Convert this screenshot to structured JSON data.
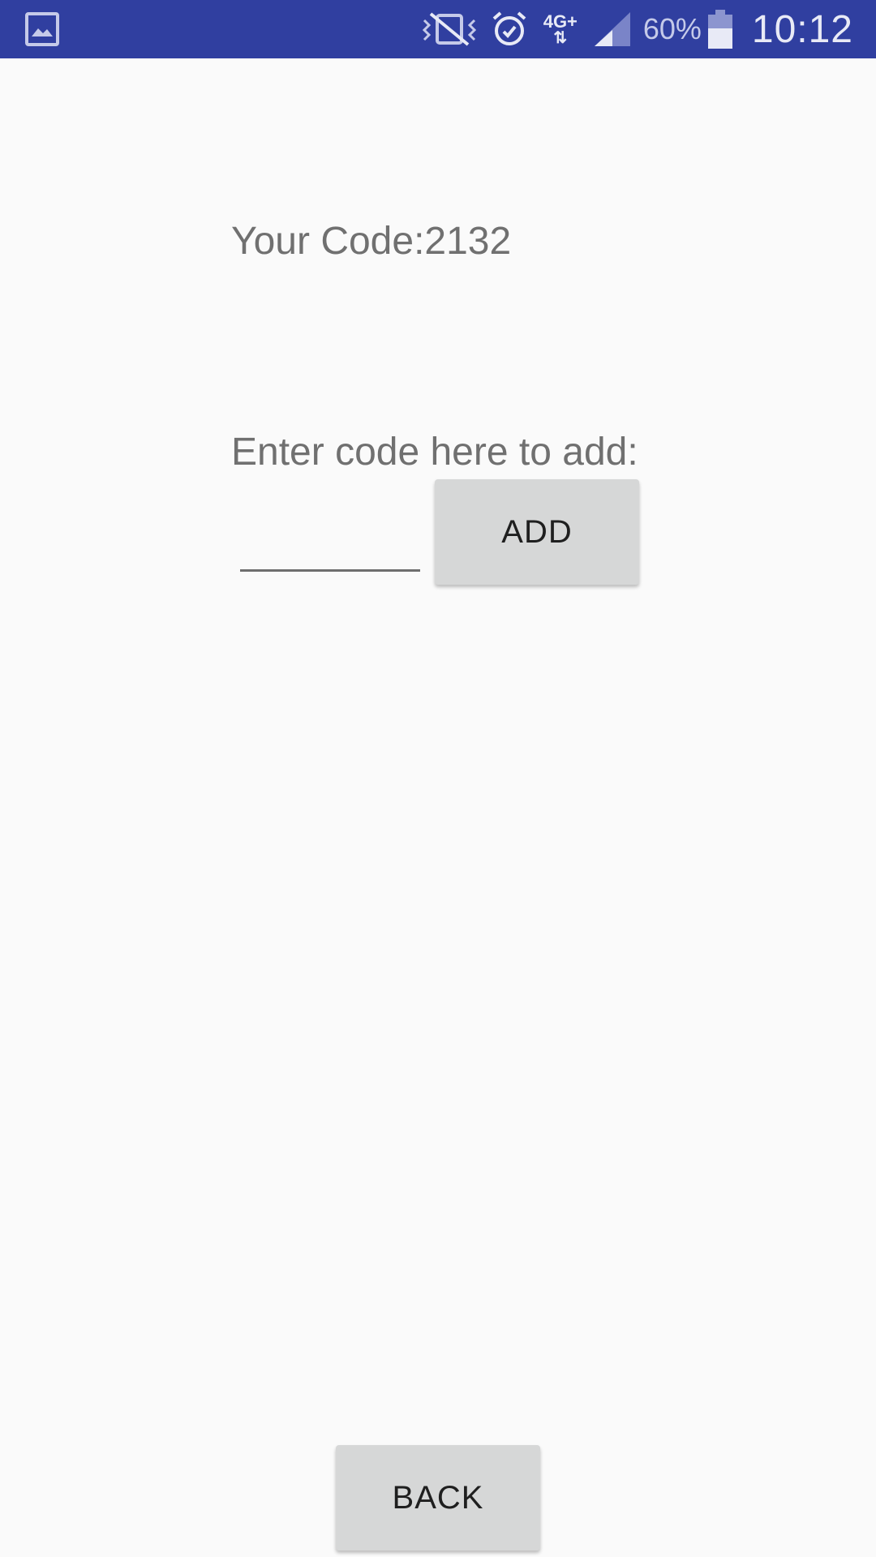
{
  "status_bar": {
    "left_icon": "gallery-icon",
    "icons": [
      "vibrate-off-icon",
      "alarm-icon",
      "signal-icon",
      "battery-icon"
    ],
    "network": "4G+",
    "network_arrows": "⇅",
    "battery_percent": "60%",
    "battery_level": 0.6,
    "time": "10:12",
    "bg_color": "#303fa0"
  },
  "main": {
    "code_label": "Your Code:2132",
    "prompt_label": "Enter code here to add:",
    "code_input_value": "",
    "code_input_placeholder": "",
    "add_button_label": "ADD",
    "back_button_label": "BACK"
  }
}
